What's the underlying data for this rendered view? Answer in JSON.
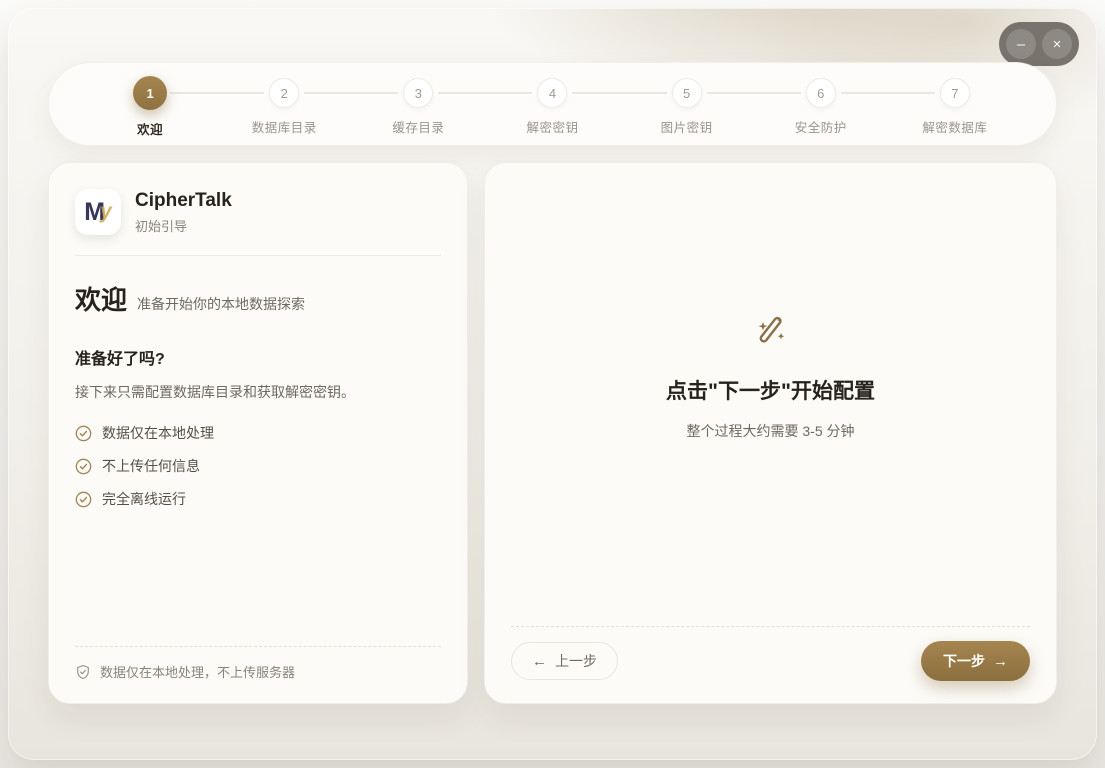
{
  "window": {
    "controls": {
      "minimize": "–",
      "close": "×"
    }
  },
  "stepper": {
    "steps": [
      {
        "num": "1",
        "label": "欢迎",
        "active": true
      },
      {
        "num": "2",
        "label": "数据库目录",
        "active": false
      },
      {
        "num": "3",
        "label": "缓存目录",
        "active": false
      },
      {
        "num": "4",
        "label": "解密密钥",
        "active": false
      },
      {
        "num": "5",
        "label": "图片密钥",
        "active": false
      },
      {
        "num": "6",
        "label": "安全防护",
        "active": false
      },
      {
        "num": "7",
        "label": "解密数据库",
        "active": false
      }
    ]
  },
  "left_panel": {
    "logo": {
      "letter_main": "M",
      "letter_accent": "y"
    },
    "app_name": "CipherTalk",
    "app_subtitle": "初始引导",
    "welcome_title": "欢迎",
    "welcome_subtitle": "准备开始你的本地数据探索",
    "ready_heading": "准备好了吗?",
    "ready_text": "接下来只需配置数据库目录和获取解密密钥。",
    "checklist": [
      "数据仅在本地处理",
      "不上传任何信息",
      "完全离线运行"
    ],
    "footer_note": "数据仅在本地处理，不上传服务器"
  },
  "right_panel": {
    "cta_title": "点击\"下一步\"开始配置",
    "cta_subtitle": "整个过程大约需要 3-5 分钟",
    "prev_arrow": "←",
    "prev_label": "上一步",
    "next_label": "下一步",
    "next_arrow": "→"
  },
  "colors": {
    "accent": "#9c7d4d",
    "accent_dark": "#8c6f3f",
    "card_bg": "#fcfbf8",
    "text_dark": "#26221c",
    "text_gray": "#6f695f",
    "text_light": "#9b958a"
  }
}
